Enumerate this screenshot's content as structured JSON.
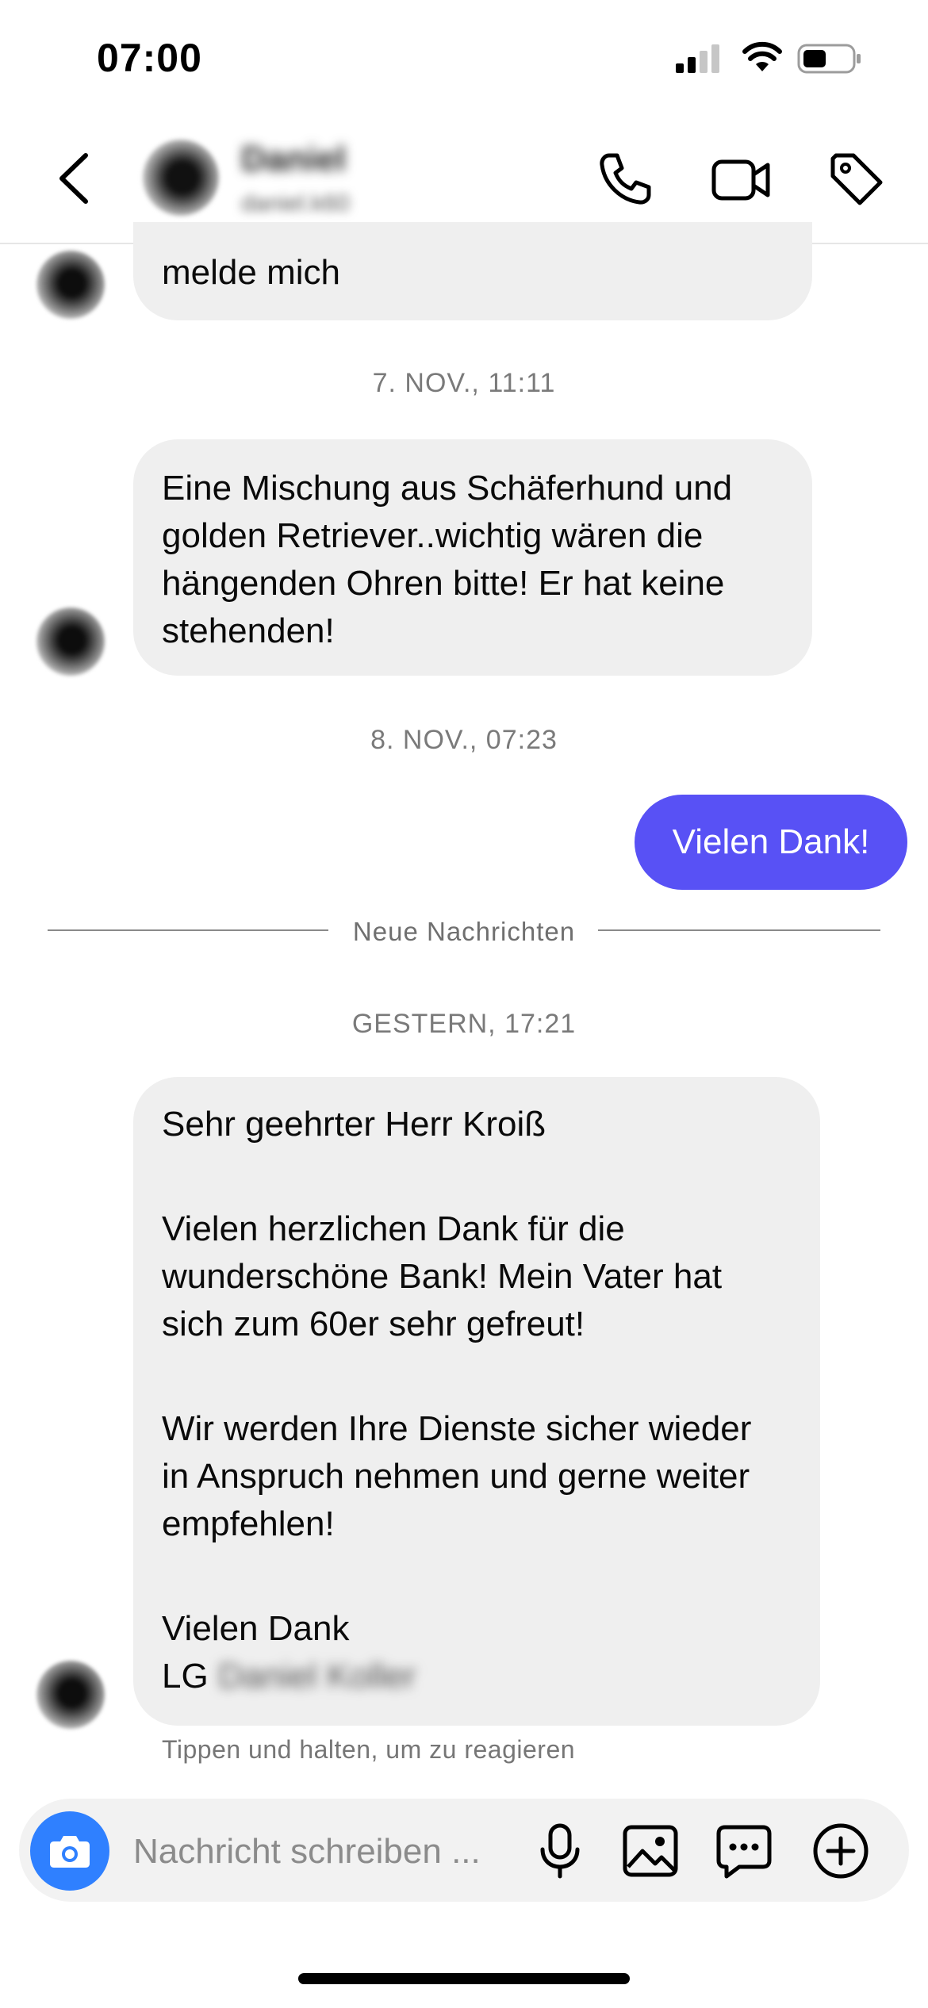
{
  "status_bar": {
    "time": "07:00"
  },
  "header": {
    "contact_name": "Daniel",
    "contact_username": "daniel.k60"
  },
  "messages": {
    "m1_text": "melde mich",
    "ts1": "7. NOV., 11:11",
    "m2_text": "Eine Mischung aus Schäferhund und golden Retriever..wichtig wären die hängenden Ohren bitte! Er hat keine stehenden!",
    "ts2": "8. NOV., 07:23",
    "m3_text": "Vielen Dank!",
    "divider_label": "Neue Nachrichten",
    "ts3": "GESTERN, 17:21",
    "m4_greeting": "Sehr geehrter Herr Kroiß",
    "m4_p1": "Vielen herzlichen Dank für die wunderschöne Bank! Mein Vater hat sich zum 60er sehr gefreut!",
    "m4_p2": "Wir werden Ihre Dienste sicher wieder in Anspruch nehmen und gerne weiter empfehlen!",
    "m4_closing": "Vielen Dank",
    "m4_sign_prefix": "LG",
    "m4_sign_name": "Daniel Koller",
    "reaction_hint": "Tippen und halten, um zu reagieren"
  },
  "composer": {
    "placeholder": "Nachricht schreiben ..."
  },
  "colors": {
    "outgoing_bubble": "#5851f5",
    "incoming_bubble": "#efefef",
    "camera_button": "#2f80ff"
  },
  "icons": [
    "back-arrow-icon",
    "phone-icon",
    "video-camera-icon",
    "tag-icon",
    "camera-icon",
    "microphone-icon",
    "gallery-icon",
    "sticker-chat-icon",
    "plus-circle-icon"
  ]
}
